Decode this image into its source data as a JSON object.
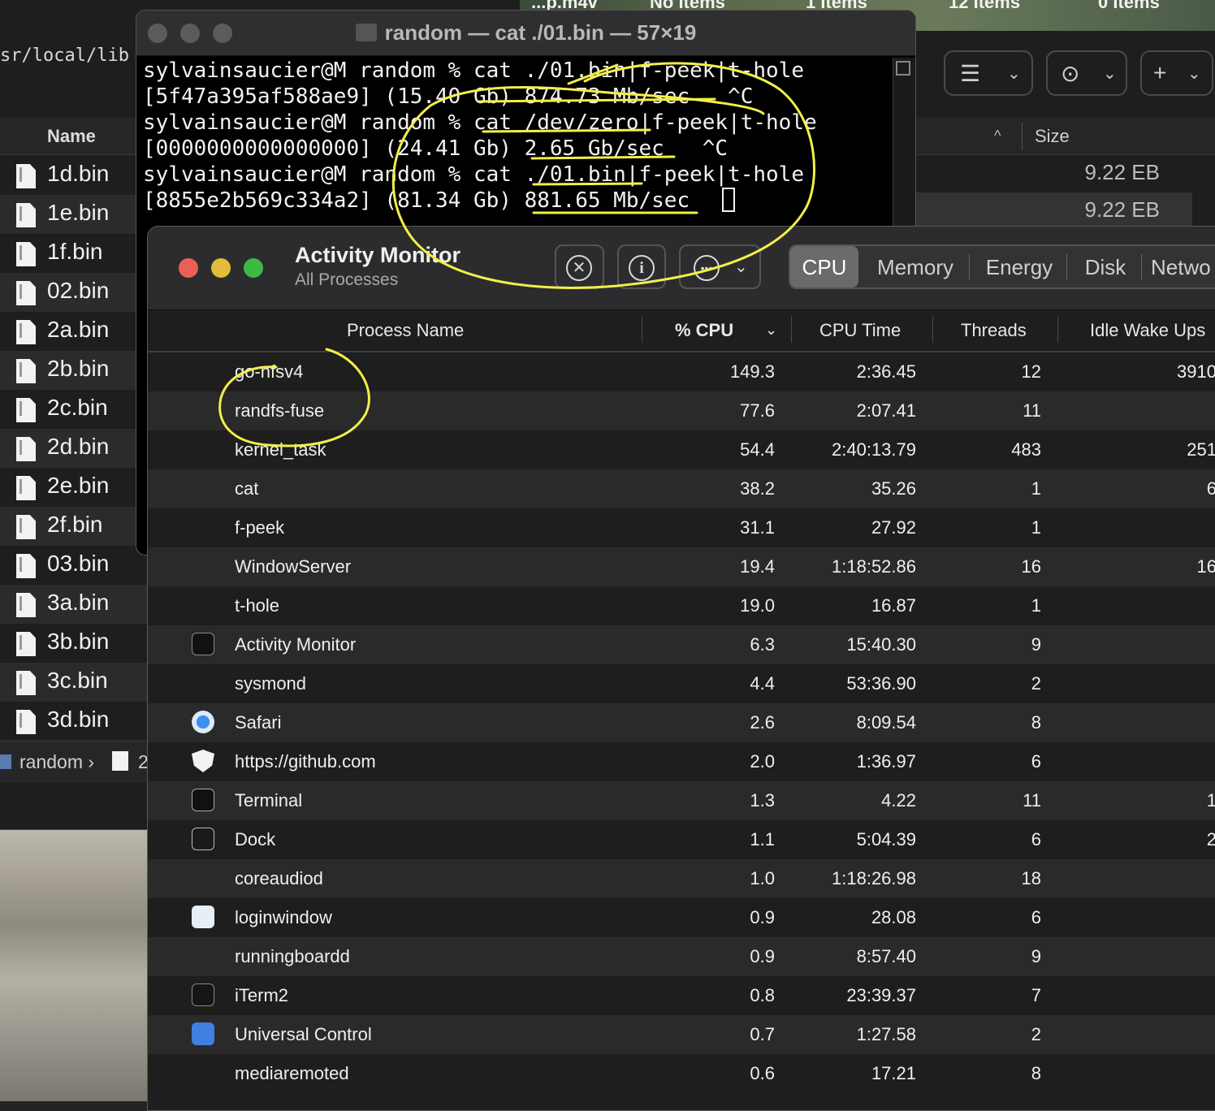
{
  "finder": {
    "path_text": "sr/local/lib",
    "name_header": "Name",
    "size_header": "Size",
    "desktop_labels": [
      "...p.m4v",
      "No Items",
      "1 Items",
      "12 Items",
      "0 Items"
    ],
    "files": [
      "1d.bin",
      "1e.bin",
      "1f.bin",
      "02.bin",
      "2a.bin",
      "2b.bin",
      "2c.bin",
      "2d.bin",
      "2e.bin",
      "2f.bin",
      "03.bin",
      "3a.bin",
      "3b.bin",
      "3c.bin",
      "3d.bin"
    ],
    "sizes": [
      "9.22 EB",
      "9.22 EB"
    ],
    "breadcrumb": "random",
    "breadcrumb_sep": "›",
    "breadcrumb_file": "2"
  },
  "terminal": {
    "title": "random — cat ./01.bin — 57×19",
    "lines": [
      "sylvainsaucier@M random % cat ./01.bin|f-peek|t-hole",
      "[5f47a395af588ae9] (15.40 Gb) 874.73 Mb/sec   ^C",
      "sylvainsaucier@M random % cat /dev/zero|f-peek|t-hole",
      "[0000000000000000] (24.41 Gb) 2.65 Gb/sec   ^C",
      "sylvainsaucier@M random % cat ./01.bin|f-peek|t-hole",
      "[8855e2b569c334a2] (81.34 Gb) 881.65 Mb/sec"
    ]
  },
  "activity_monitor": {
    "title": "Activity Monitor",
    "subtitle": "All Processes",
    "tabs": [
      "CPU",
      "Memory",
      "Energy",
      "Disk",
      "Netwo"
    ],
    "active_tab": "CPU",
    "columns": {
      "name": "Process Name",
      "cpu": "% CPU",
      "cpu_time": "CPU Time",
      "threads": "Threads",
      "idle": "Idle Wake Ups"
    },
    "processes": [
      {
        "name": "go-nfsv4",
        "cpu": "149.3",
        "time": "2:36.45",
        "threads": "12",
        "idle": "3910",
        "icon": ""
      },
      {
        "name": "randfs-fuse",
        "cpu": "77.6",
        "time": "2:07.41",
        "threads": "11",
        "idle": "",
        "icon": ""
      },
      {
        "name": "kernel_task",
        "cpu": "54.4",
        "time": "2:40:13.79",
        "threads": "483",
        "idle": "251",
        "icon": ""
      },
      {
        "name": "cat",
        "cpu": "38.2",
        "time": "35.26",
        "threads": "1",
        "idle": "6",
        "icon": ""
      },
      {
        "name": "f-peek",
        "cpu": "31.1",
        "time": "27.92",
        "threads": "1",
        "idle": "",
        "icon": ""
      },
      {
        "name": "WindowServer",
        "cpu": "19.4",
        "time": "1:18:52.86",
        "threads": "16",
        "idle": "16",
        "icon": ""
      },
      {
        "name": "t-hole",
        "cpu": "19.0",
        "time": "16.87",
        "threads": "1",
        "idle": "",
        "icon": ""
      },
      {
        "name": "Activity Monitor",
        "cpu": "6.3",
        "time": "15:40.30",
        "threads": "9",
        "idle": "",
        "icon": "activity-monitor-icon"
      },
      {
        "name": "sysmond",
        "cpu": "4.4",
        "time": "53:36.90",
        "threads": "2",
        "idle": "",
        "icon": ""
      },
      {
        "name": "Safari",
        "cpu": "2.6",
        "time": "8:09.54",
        "threads": "8",
        "idle": "",
        "icon": "safari-icon"
      },
      {
        "name": "https://github.com",
        "cpu": "2.0",
        "time": "1:36.97",
        "threads": "6",
        "idle": "",
        "icon": "shield-icon"
      },
      {
        "name": "Terminal",
        "cpu": "1.3",
        "time": "4.22",
        "threads": "11",
        "idle": "1",
        "icon": "terminal-icon"
      },
      {
        "name": "Dock",
        "cpu": "1.1",
        "time": "5:04.39",
        "threads": "6",
        "idle": "2",
        "icon": "dock-icon"
      },
      {
        "name": "coreaudiod",
        "cpu": "1.0",
        "time": "1:18:26.98",
        "threads": "18",
        "idle": "",
        "icon": ""
      },
      {
        "name": "loginwindow",
        "cpu": "0.9",
        "time": "28.08",
        "threads": "6",
        "idle": "",
        "icon": "loginwindow-icon"
      },
      {
        "name": "runningboardd",
        "cpu": "0.9",
        "time": "8:57.40",
        "threads": "9",
        "idle": "",
        "icon": ""
      },
      {
        "name": "iTerm2",
        "cpu": "0.8",
        "time": "23:39.37",
        "threads": "7",
        "idle": "",
        "icon": "iterm2-icon"
      },
      {
        "name": "Universal Control",
        "cpu": "0.7",
        "time": "1:27.58",
        "threads": "2",
        "idle": "",
        "icon": "universal-control-icon"
      },
      {
        "name": "mediaremoted",
        "cpu": "0.6",
        "time": "17.21",
        "threads": "8",
        "idle": "",
        "icon": ""
      }
    ]
  },
  "colors": {
    "annotation": "#f2ef4a",
    "close": "#ec5f57",
    "minimize": "#e2bd3c",
    "zoom": "#3cba44"
  }
}
